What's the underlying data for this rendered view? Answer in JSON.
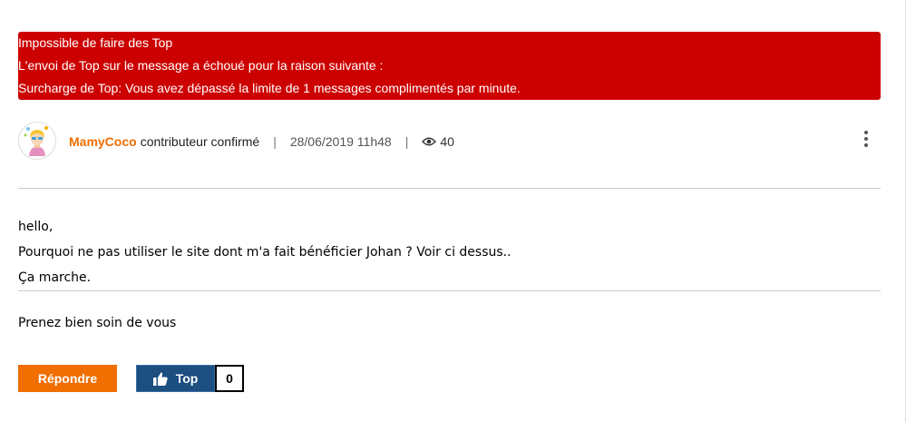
{
  "error_banner": {
    "lines": [
      "Impossible de faire des Top",
      "L'envoi de Top sur le message a échoué pour la raison suivante :",
      "Surcharge de Top: Vous avez dépassé la limite de 1 messages complimentés par minute."
    ],
    "background_color": "#cd0000"
  },
  "post": {
    "author": "MamyCoco",
    "rank": "contributeur confirmé",
    "separator": "|",
    "date": "28/06/2019 11h48",
    "views": "40",
    "views_icon": "eye-icon",
    "menu_icon": "more-vertical-icon",
    "body_lines": [
      "hello,",
      "Pourquoi ne pas utiliser le site dont m'a fait bénéficier Johan ? Voir ci dessus..",
      "Ça marche."
    ],
    "signature": "Prenez bien soin de vous"
  },
  "actions": {
    "reply_label": "Répondre",
    "top_label": "Top",
    "top_icon": "thumbs-up-icon",
    "top_count": "0"
  },
  "colors": {
    "accent_orange": "#f16e00",
    "top_button_blue": "#1c4e80"
  }
}
